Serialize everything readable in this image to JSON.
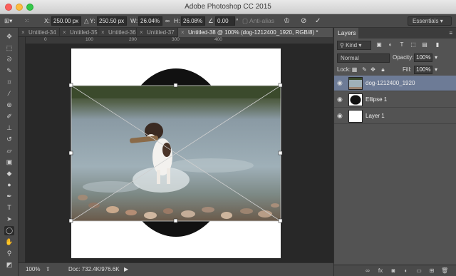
{
  "window": {
    "title": "Adobe Photoshop CC 2015"
  },
  "options": {
    "x_label": "X:",
    "x_value": "250.00 px",
    "y_label": "Y:",
    "y_value": "250.50 px",
    "w_label": "W:",
    "w_value": "26.04%",
    "h_label": "H:",
    "h_value": "26.08%",
    "angle_value": "0.00",
    "angle_unit": "°",
    "antialias_label": "Anti-alias",
    "workspace": "Essentials"
  },
  "tabs": [
    {
      "label": "Untitled-34"
    },
    {
      "label": "Untitled-35"
    },
    {
      "label": "Untitled-36"
    },
    {
      "label": "Untitled-37"
    },
    {
      "label": "Untitled-38 @ 100% (dog-1212400_1920, RGB/8) *"
    }
  ],
  "ruler": {
    "top": [
      "0",
      "100",
      "200",
      "300",
      "400"
    ]
  },
  "status": {
    "zoom": "100%",
    "doc": "Doc: 732.4K/976.6K"
  },
  "layers_panel": {
    "tab": "Layers",
    "kind": "Kind",
    "blend_mode": "Normal",
    "opacity_label": "Opacity:",
    "opacity_value": "100%",
    "lock_label": "Lock:",
    "fill_label": "Fill:",
    "fill_value": "100%",
    "layers": [
      {
        "name": "dog-1212400_1920",
        "selected": true
      },
      {
        "name": "Ellipse 1",
        "selected": false
      },
      {
        "name": "Layer 1",
        "selected": false
      }
    ]
  },
  "colors": {
    "selected_layer": "#6d7b96",
    "canvas_bg": "#282828",
    "ellipse": "#111111"
  }
}
